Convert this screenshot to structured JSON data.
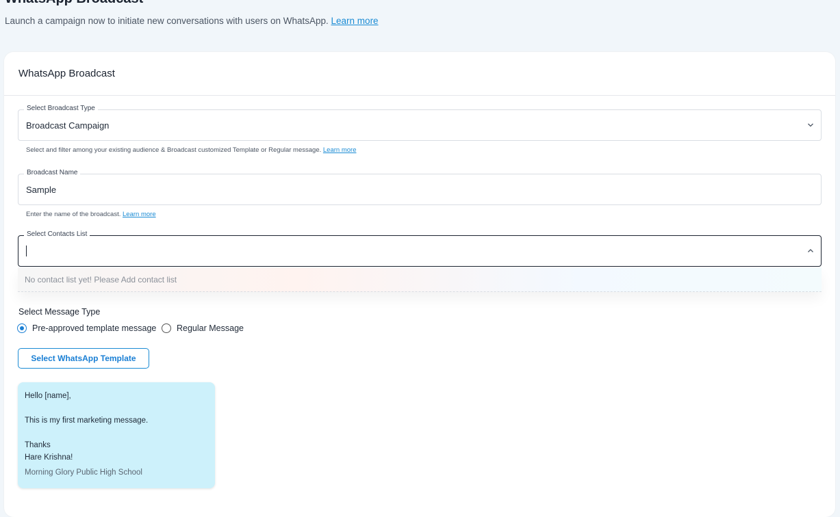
{
  "header": {
    "title": "WhatsApp Broadcast",
    "subtitle": "Launch a campaign now to initiate new conversations with users on WhatsApp.",
    "learn_more": "Learn more"
  },
  "card": {
    "title": "WhatsApp Broadcast"
  },
  "broadcast_type": {
    "legend": "Select Broadcast Type",
    "value": "Broadcast Campaign",
    "helper": "Select and filter among your existing audience & Broadcast customized Template or Regular message.",
    "helper_link": "Learn more"
  },
  "broadcast_name": {
    "legend": "Broadcast Name",
    "value": "Sample",
    "helper": "Enter the name of the broadcast.",
    "helper_link": "Learn more"
  },
  "contacts_list": {
    "legend": "Select Contacts List",
    "value": "",
    "empty_option": "No contact list yet! Please Add contact list"
  },
  "message_type": {
    "label": "Select Message Type",
    "options": [
      {
        "label": "Pre-approved template message",
        "selected": true
      },
      {
        "label": "Regular Message",
        "selected": false
      }
    ]
  },
  "template_button": {
    "label": "Select WhatsApp Template"
  },
  "preview": {
    "greeting": "Hello [name],",
    "body": "This is my first marketing message.",
    "closing_1": "Thanks",
    "closing_2": "Hare Krishna!",
    "footer": "Morning Glory Public High School"
  },
  "colors": {
    "accent": "#1a8bd4",
    "preview_bg": "#cdf1fb",
    "page_bg": "#f1f6fa"
  }
}
